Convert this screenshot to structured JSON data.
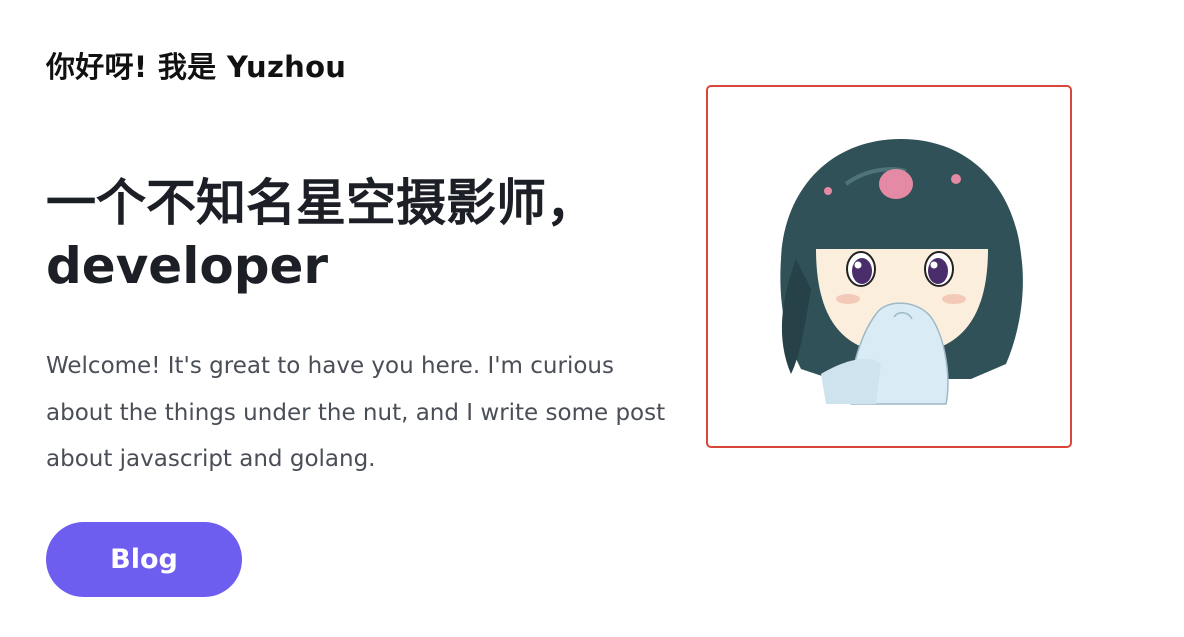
{
  "hero": {
    "greeting": "你好呀! 我是 Yuzhou",
    "headline": "一个不知名星空摄影师，developer",
    "intro": "Welcome! It's great to have you here. I'm curious about the things under the nut, and I write some post about javascript and golang.",
    "button_label": "Blog"
  },
  "avatar": {
    "icon": "anime-girl-avatar"
  },
  "colors": {
    "accent": "#6d5ef0",
    "frame_border": "#d9473a",
    "heading": "#1c1f26",
    "body_text": "#4a4e57"
  }
}
